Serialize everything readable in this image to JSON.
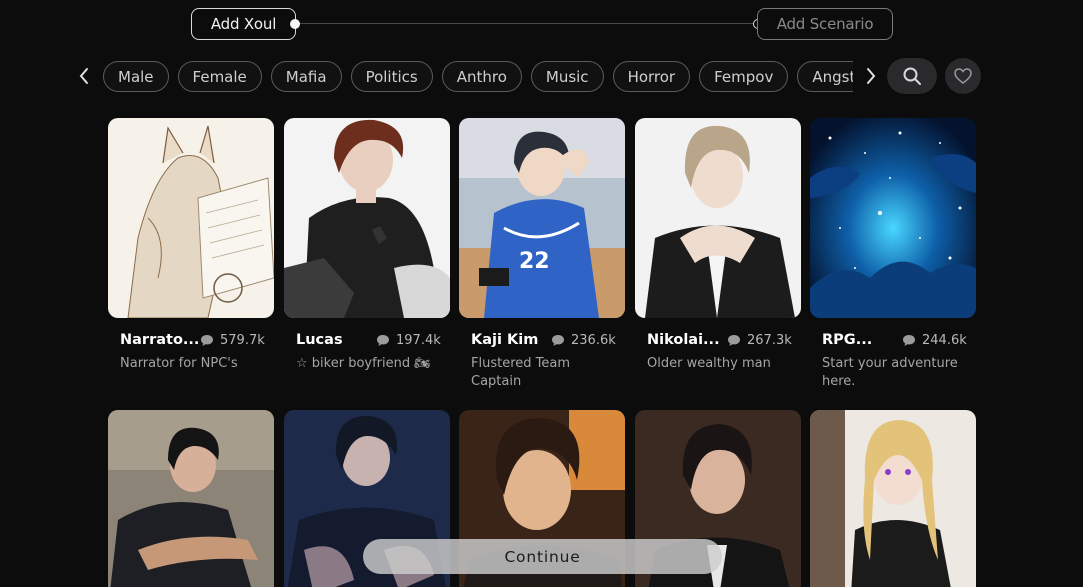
{
  "stepper": {
    "step1": "Add Xoul",
    "step2": "Add Scenario"
  },
  "categories": [
    "Male",
    "Female",
    "Mafia",
    "Politics",
    "Anthro",
    "Music",
    "Horror",
    "Fempov",
    "Angst"
  ],
  "icons": {
    "prev": "chevron-left-icon",
    "next": "chevron-right-icon",
    "search": "search-icon",
    "favorite": "heart-icon",
    "comments": "comment-icon"
  },
  "cards": [
    {
      "name": "Narrato...",
      "count": "579.7k",
      "desc": "Narrator for NPC's"
    },
    {
      "name": "Lucas",
      "count": "197.4k",
      "desc": "☆ biker boyfriend 🏍"
    },
    {
      "name": "Kaji Kim",
      "count": "236.6k",
      "desc": "Flustered Team Captain"
    },
    {
      "name": "Nikolai...",
      "count": "267.3k",
      "desc": "Older wealthy man"
    },
    {
      "name": "RPG...",
      "count": "244.6k",
      "desc": "Start your adventure here."
    }
  ],
  "continue_label": "Continue"
}
